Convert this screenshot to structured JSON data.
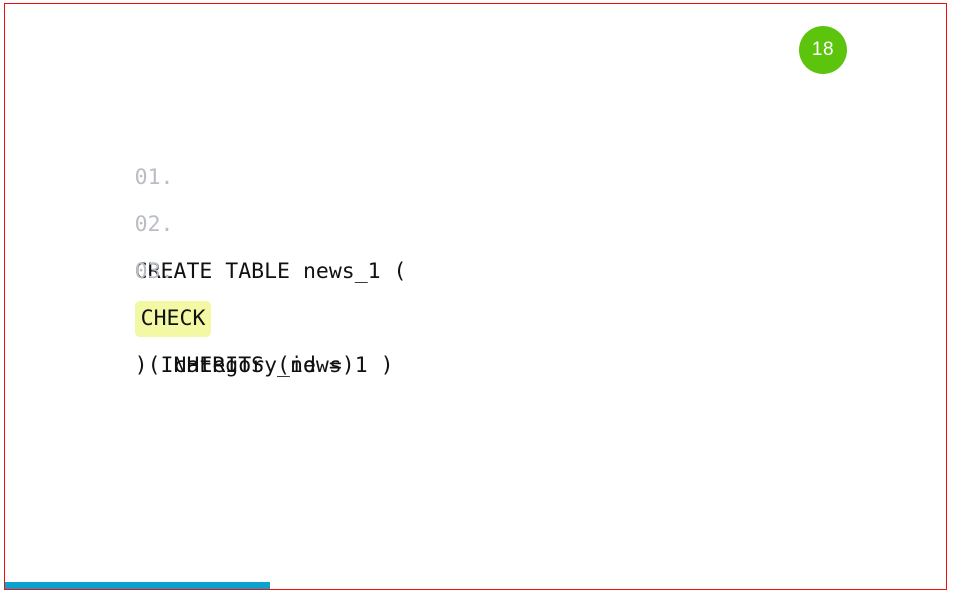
{
  "slide": {
    "number_badge": "18",
    "badge_color": "#5cc40c",
    "border_color": "#f50b0b",
    "background": "#ffffff"
  },
  "code": {
    "language": "sql",
    "lines": [
      {
        "number": "01.",
        "indent": "",
        "before": "CREATE TABLE news_1 (",
        "highlight": "",
        "after": ""
      },
      {
        "number": "02.",
        "indent": "    ",
        "before": "",
        "highlight": "CHECK",
        "after": " ( category_id = 1 )"
      },
      {
        "number": "03.",
        "indent": "",
        "before": ") INHERITS (news)",
        "highlight": "",
        "after": ""
      }
    ],
    "highlight_color": "#f3f8a5",
    "line_number_color": "#b9bdc4",
    "text_color": "#111111"
  },
  "progress": {
    "percent": "28",
    "fill_width_px": "265",
    "color": "#0aa3cf"
  }
}
